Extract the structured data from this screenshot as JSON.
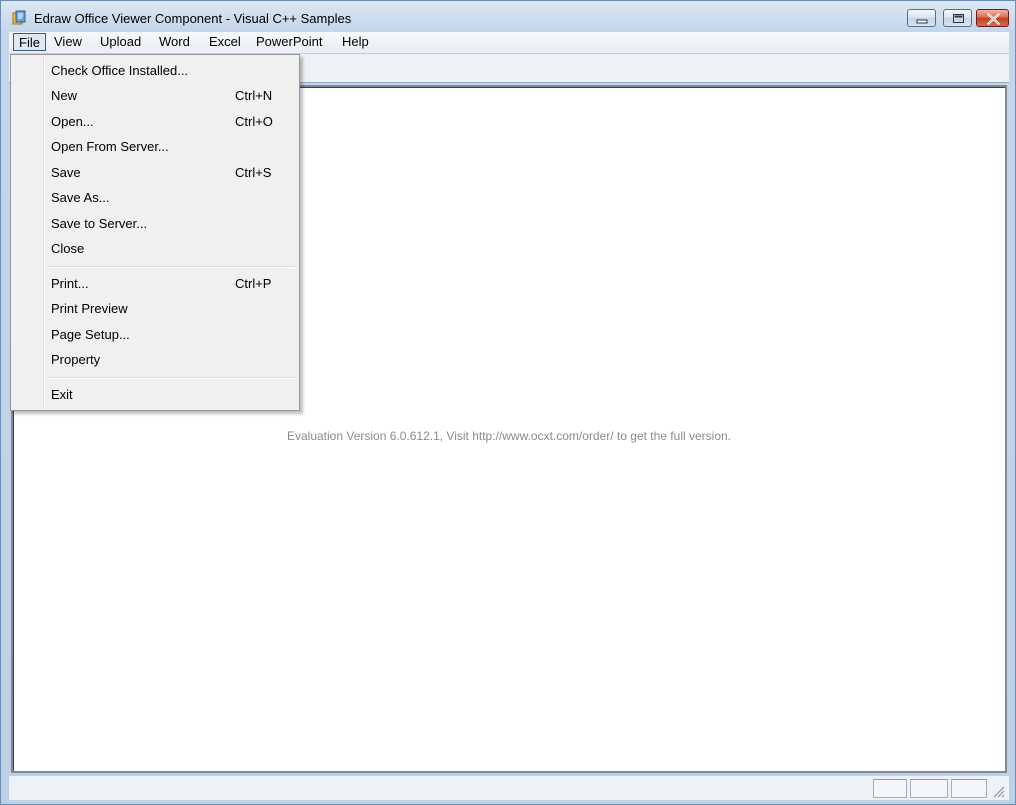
{
  "window": {
    "title": "Edraw Office Viewer Component - Visual C++ Samples"
  },
  "menubar": {
    "items": [
      "File",
      "View",
      "Upload",
      "Word",
      "Excel",
      "PowerPoint",
      "Help"
    ],
    "active": "File"
  },
  "file_menu": {
    "groups": [
      [
        {
          "label": "Check Office Installed...",
          "shortcut": ""
        },
        {
          "label": "New",
          "shortcut": "Ctrl+N"
        },
        {
          "label": "Open...",
          "shortcut": "Ctrl+O"
        },
        {
          "label": "Open From Server...",
          "shortcut": ""
        },
        {
          "label": "Save",
          "shortcut": "Ctrl+S"
        },
        {
          "label": "Save As...",
          "shortcut": ""
        },
        {
          "label": "Save to Server...",
          "shortcut": ""
        },
        {
          "label": "Close",
          "shortcut": ""
        }
      ],
      [
        {
          "label": "Print...",
          "shortcut": "Ctrl+P"
        },
        {
          "label": "Print Preview",
          "shortcut": ""
        },
        {
          "label": "Page Setup...",
          "shortcut": ""
        },
        {
          "label": "Property",
          "shortcut": ""
        }
      ],
      [
        {
          "label": "Exit",
          "shortcut": ""
        }
      ]
    ]
  },
  "content": {
    "evaluation_notice": "Evaluation Version 6.0.612.1, Visit http://www.ocxt.com/order/ to get the full version."
  },
  "icons": {
    "app": "app-icon",
    "minimize": "minimize-icon",
    "maximize": "maximize-icon",
    "close": "close-icon",
    "resize_grip": "resize-grip-icon"
  },
  "colors": {
    "close_button": "#c63b1f",
    "menu_background": "#f0f0f0",
    "title_bar": "#c4d6ea"
  }
}
